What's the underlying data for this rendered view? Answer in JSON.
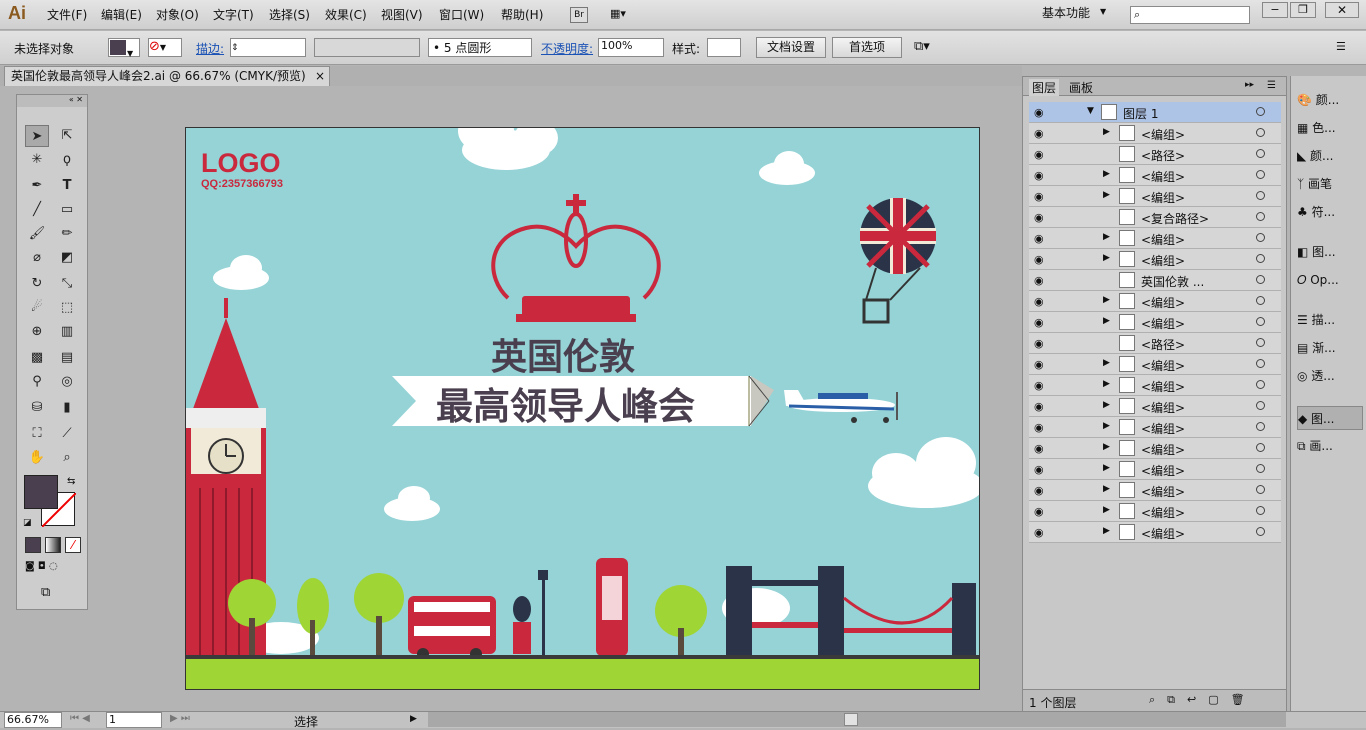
{
  "app": {
    "logo": "Ai",
    "menus": [
      "文件(F)",
      "编辑(E)",
      "对象(O)",
      "文字(T)",
      "选择(S)",
      "效果(C)",
      "视图(V)",
      "窗口(W)",
      "帮助(H)"
    ],
    "br": "Br",
    "workspace": "基本功能"
  },
  "control": {
    "selection": "未选择对象",
    "stroke_label": "描边:",
    "brush": "5 点圆形",
    "opacity_label": "不透明度:",
    "opacity": "100%",
    "style_label": "样式:",
    "doc_setup": "文档设置",
    "prefs": "首选项"
  },
  "tab": {
    "title": "英国伦敦最高领导人峰会2.ai @ 66.67% (CMYK/预览)",
    "close": "×"
  },
  "artwork": {
    "logo": "LOGO",
    "qq": "QQ:2357366793",
    "title1": "英国伦敦",
    "title2": "最高领导人峰会"
  },
  "layers": {
    "tabs": [
      "图层",
      "画板"
    ],
    "top": "图层 1",
    "items": [
      "<编组>",
      "<路径>",
      "<编组>",
      "<编组>",
      "<复合路径>",
      "<编组>",
      "<编组>",
      "英国伦敦 ...",
      "<编组>",
      "<编组>",
      "<路径>",
      "<编组>",
      "<编组>",
      "<编组>",
      "<编组>",
      "<编组>",
      "<编组>",
      "<编组>",
      "<编组>",
      "<编组>"
    ],
    "count": "1 个图层"
  },
  "rightpanel": [
    "颜...",
    "色...",
    "颜...",
    "画笔",
    "符...",
    "图...",
    "Op...",
    "描...",
    "渐...",
    "透...",
    "图...",
    "画..."
  ],
  "status": {
    "zoom": "66.67%",
    "page": "1",
    "mode": "选择"
  },
  "colors": {
    "fill": "#4a3f4f",
    "sky": "#95d3d6",
    "red": "#c9283d",
    "grass": "#9fd534"
  }
}
